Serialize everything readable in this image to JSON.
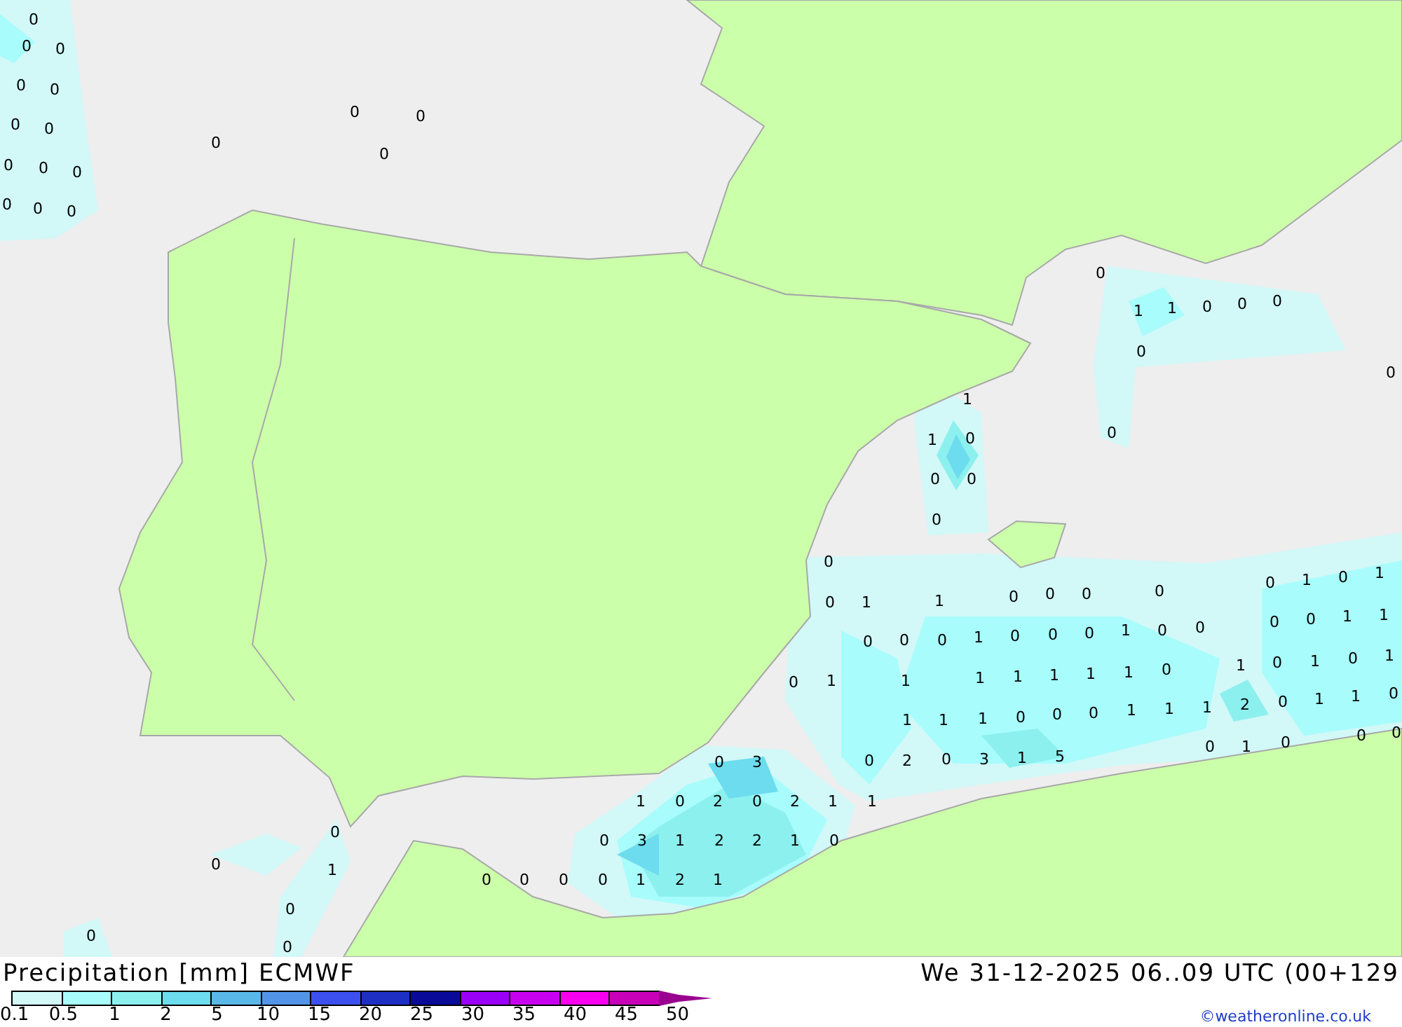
{
  "map": {
    "labels": [
      "0",
      "0",
      "0",
      "0",
      "0",
      "0",
      "0",
      "0",
      "0",
      "0",
      "0",
      "0",
      "0",
      "0",
      "0",
      "0",
      "0",
      "0",
      "1",
      "1",
      "0",
      "0",
      "0",
      "0",
      "0",
      "0",
      "1",
      "1",
      "0",
      "0",
      "0",
      "0",
      "0",
      "0",
      "1",
      "1",
      "0",
      "0",
      "0",
      "0",
      "0",
      "1",
      "0",
      "1",
      "0",
      "0",
      "0",
      "1",
      "0",
      "0",
      "0",
      "1",
      "0",
      "0",
      "0",
      "0",
      "1",
      "1",
      "0",
      "1",
      "1",
      "1",
      "1",
      "1",
      "1",
      "1",
      "0",
      "1",
      "0",
      "1",
      "0",
      "1",
      "1",
      "1",
      "1",
      "0",
      "0",
      "0",
      "1",
      "1",
      "1",
      "2",
      "0",
      "1",
      "1",
      "0",
      "0",
      "1",
      "0",
      "0",
      "0",
      "0",
      "2",
      "0",
      "3",
      "1",
      "5",
      "0",
      "3",
      "1",
      "0",
      "2",
      "0",
      "2",
      "1",
      "1",
      "0",
      "3",
      "1",
      "2",
      "2",
      "1",
      "0",
      "0",
      "0",
      "0",
      "0",
      "1",
      "2",
      "1",
      "0",
      "0",
      "1",
      "0",
      "0",
      "0"
    ]
  },
  "legend": {
    "title": "Precipitation [mm] ECMWF",
    "swatches": [
      {
        "kind": "band",
        "color": "#d2f8f8"
      },
      {
        "kind": "band",
        "color": "#a8fcfc"
      },
      {
        "kind": "band",
        "color": "#8cf0ee"
      },
      {
        "kind": "band",
        "color": "#6cdcee"
      },
      {
        "kind": "band",
        "color": "#5ab8e8"
      },
      {
        "kind": "band",
        "color": "#5294e8"
      },
      {
        "kind": "band",
        "color": "#3c50f0"
      },
      {
        "kind": "band",
        "color": "#1e30c4"
      },
      {
        "kind": "band",
        "color": "#0a0a98"
      },
      {
        "kind": "band",
        "color": "#9a00f8"
      },
      {
        "kind": "band",
        "color": "#c800f0"
      },
      {
        "kind": "band",
        "color": "#f800f0"
      },
      {
        "kind": "band",
        "color": "#c800b8"
      },
      {
        "kind": "arrow",
        "color": "#9a0090"
      }
    ],
    "ticks": [
      "0.1",
      "0.5",
      "1",
      "2",
      "5",
      "10",
      "15",
      "20",
      "25",
      "30",
      "35",
      "40",
      "45",
      "50"
    ]
  },
  "valid_time": "We 31-12-2025 06..09 UTC (00+129",
  "credit": "©weatheronline.co.uk"
}
